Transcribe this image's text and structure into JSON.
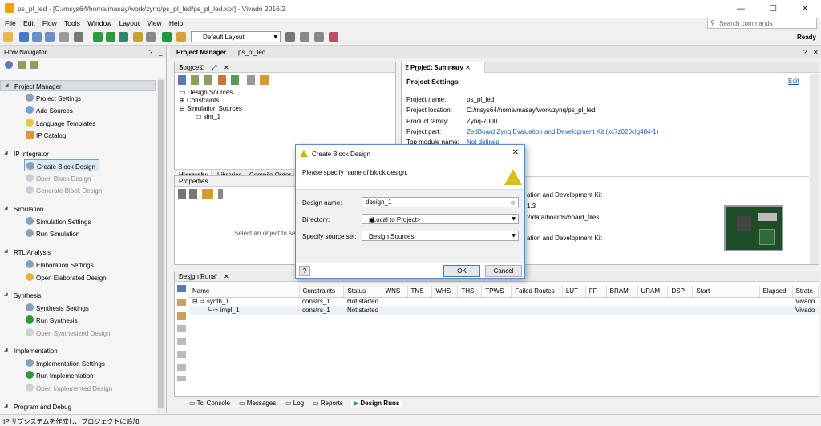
{
  "window": {
    "title": "ps_pl_led - [C:/msys64/home/masay/work/zynq/ps_pl_led/ps_pl_led.xpr] - Vivado 2016.2"
  },
  "window_controls": {
    "minimize": "—",
    "maximize": "☐",
    "close": "✕"
  },
  "menu": [
    "File",
    "Edit",
    "Flow",
    "Tools",
    "Window",
    "Layout",
    "View",
    "Help"
  ],
  "search": {
    "placeholder": "Search commands"
  },
  "toolbar": {
    "layout_value": "Default Layout",
    "status": "Ready"
  },
  "flow_navigator": {
    "title": "Flow Navigator",
    "sections": [
      {
        "label": "Project Manager",
        "items": [
          "Project Settings",
          "Add Sources",
          "Language Templates",
          "IP Catalog"
        ]
      },
      {
        "label": "IP Integrator",
        "items": [
          "Create Block Design",
          "Open Block Design",
          "Generate Block Design"
        ]
      },
      {
        "label": "Simulation",
        "items": [
          "Simulation Settings",
          "Run Simulation"
        ]
      },
      {
        "label": "RTL Analysis",
        "items": [
          "Elaboration Settings",
          "Open Elaborated Design"
        ]
      },
      {
        "label": "Synthesis",
        "items": [
          "Synthesis Settings",
          "Run Synthesis",
          "Open Synthesized Design"
        ]
      },
      {
        "label": "Implementation",
        "items": [
          "Implementation Settings",
          "Run Implementation",
          "Open Implemented Design"
        ]
      },
      {
        "label": "Program and Debug",
        "items": []
      }
    ]
  },
  "project_manager": {
    "title": "Project Manager",
    "project": "ps_pl_led"
  },
  "sources": {
    "title": "Sources",
    "tree": [
      "Design Sources",
      "Constraints",
      "Simulation Sources",
      "sim_1"
    ],
    "tabs": [
      "Hierarchy",
      "Libraries",
      "Compile Order"
    ]
  },
  "properties": {
    "title": "Properties",
    "hint": "Select an object to see properties"
  },
  "summary": {
    "tab": "Project Summary",
    "section": "Project Settings",
    "edit": "Edit",
    "rows": [
      {
        "label": "Project name:",
        "value": "ps_pl_led"
      },
      {
        "label": "Project location:",
        "value": "C:/msys64/home/masay/work/zynq/ps_pl_led"
      },
      {
        "label": "Product family:",
        "value": "Zynq-7000"
      },
      {
        "label": "Project part:",
        "value": "ZedBoard Zynq Evaluation and Development Kit (xc7z020clg484-1)"
      },
      {
        "label": "Top module name:",
        "value": "Not defined"
      }
    ],
    "board_lines": [
      "ation and Development Kit",
      "1.3",
      "2/data/boards/board_files",
      "ation and Development Kit"
    ]
  },
  "design_runs": {
    "title": "Design Runs",
    "columns": [
      "Name",
      "Constraints",
      "Status",
      "WNS",
      "TNS",
      "WHS",
      "THS",
      "TPWS",
      "Failed Routes",
      "LUT",
      "FF",
      "BRAM",
      "URAM",
      "DSP",
      "Start",
      "Elapsed",
      "Strate"
    ],
    "rows": [
      {
        "name": "synth_1",
        "constraints": "constrs_1",
        "status": "Not started",
        "strategy": "Vivado"
      },
      {
        "name": "impl_1",
        "constraints": "constrs_1",
        "status": "Not started",
        "strategy": "Vivado"
      }
    ]
  },
  "bottom_tabs": [
    "Tcl Console",
    "Messages",
    "Log",
    "Reports",
    "Design Runs"
  ],
  "status_bar": {
    "text": "IP サブシステムを作成し、プロジェクトに追加"
  },
  "dialog": {
    "title": "Create Block Design",
    "message": "Please specify name of block design.",
    "name_label": "Design name:",
    "name_value": "design_1",
    "dir_label": "Directory:",
    "dir_value": "<Local to Project>",
    "srcset_label": "Specify source set:",
    "srcset_value": "Design Sources",
    "help": "?",
    "ok": "OK",
    "cancel": "Cancel"
  }
}
